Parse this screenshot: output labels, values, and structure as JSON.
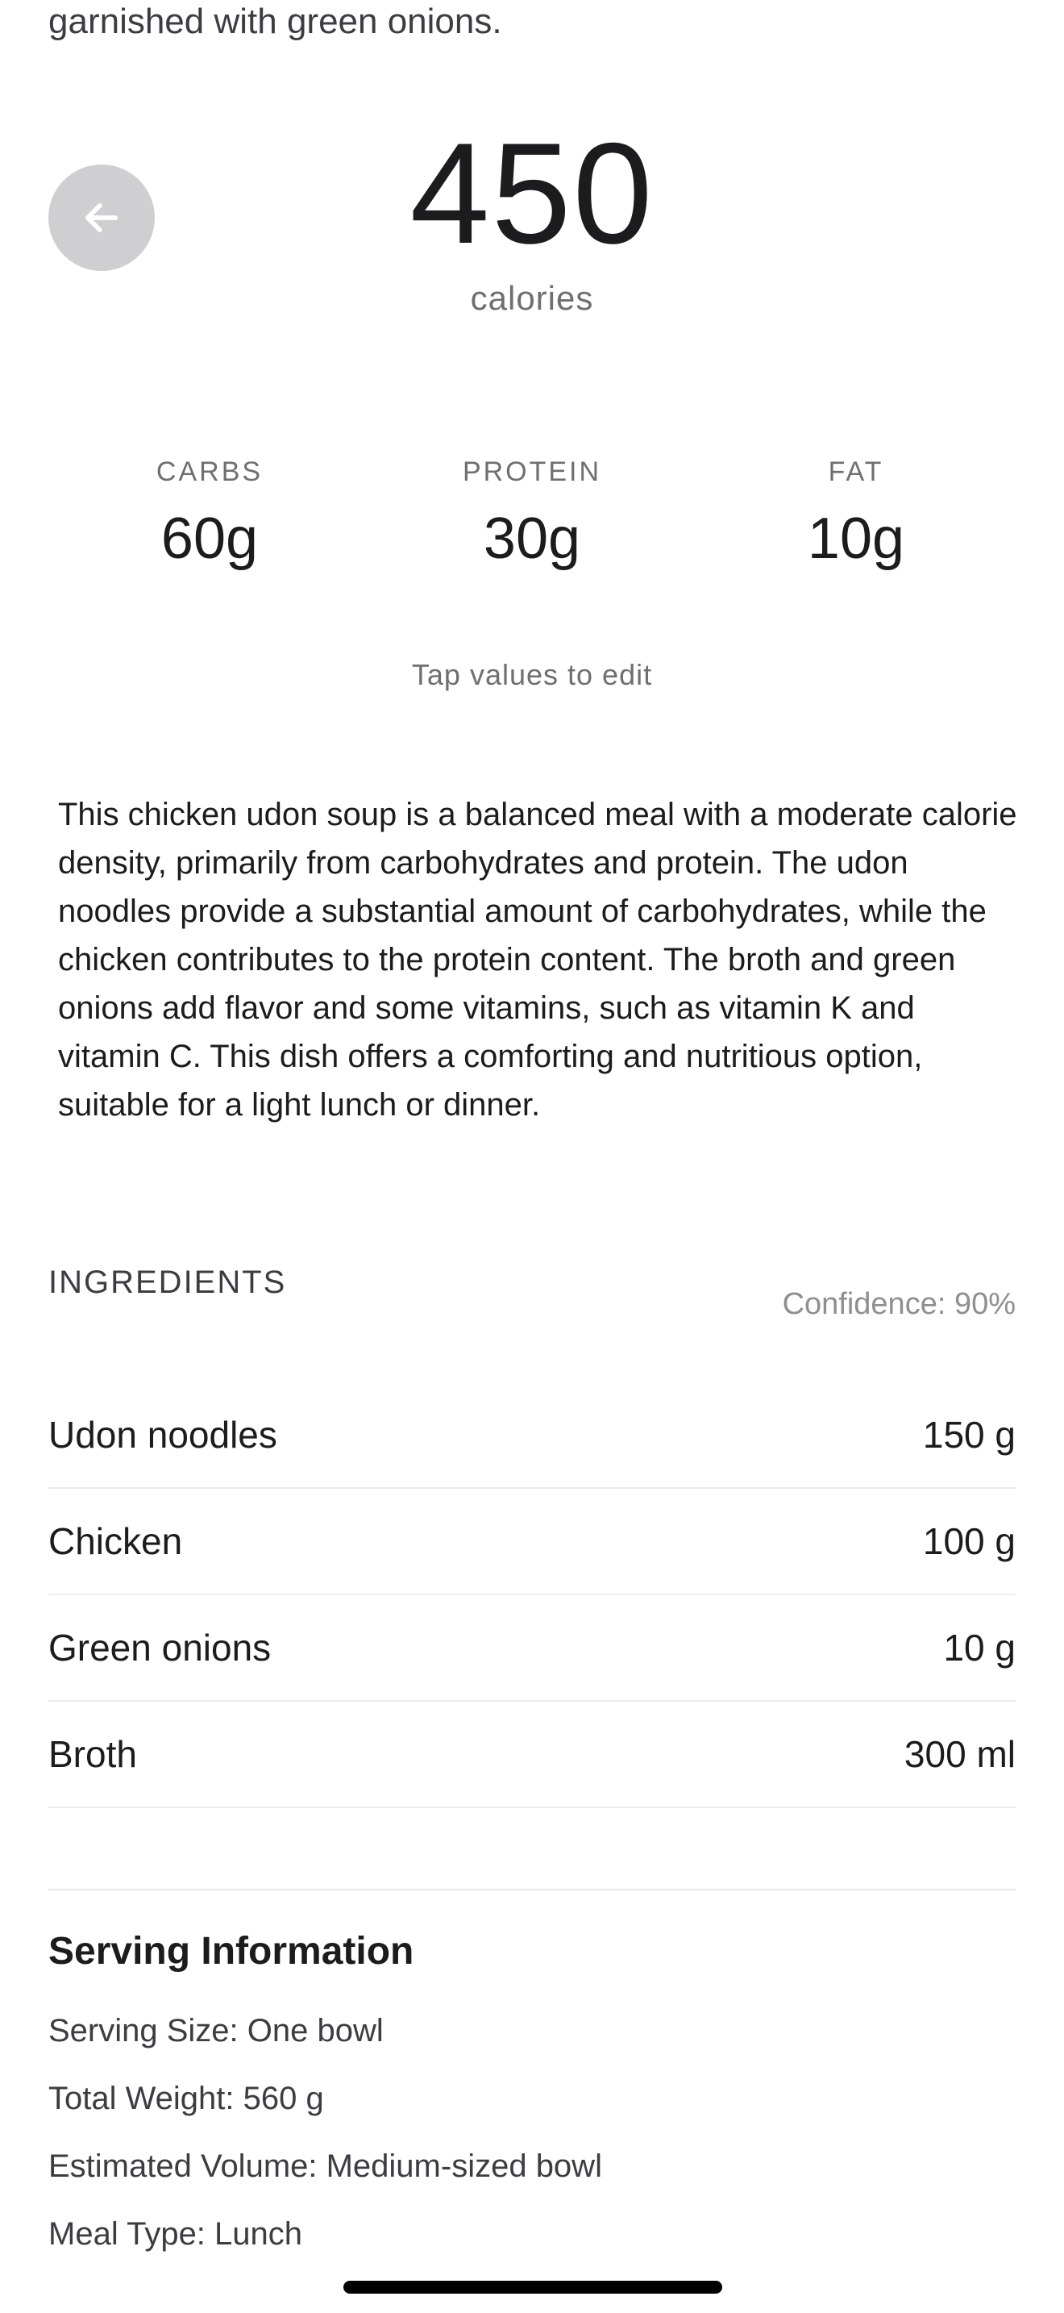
{
  "description_tail": "garnished with green onions.",
  "calories": {
    "value": "450",
    "label": "calories"
  },
  "macros": [
    {
      "label": "CARBS",
      "value": "60g"
    },
    {
      "label": "PROTEIN",
      "value": "30g"
    },
    {
      "label": "FAT",
      "value": "10g"
    }
  ],
  "tap_hint": "Tap values to edit",
  "summary": "This chicken udon soup is a balanced meal with a moderate calorie density, primarily from carbohydrates and protein. The udon noodles provide a substantial amount of carbohydrates, while the chicken contributes to the protein content. The broth and green onions add flavor and some vitamins, such as vitamin K and vitamin C. This dish offers a comforting and nutritious option, suitable for a light lunch or dinner.",
  "ingredients": {
    "title": "INGREDIENTS",
    "confidence": "Confidence: 90%",
    "items": [
      {
        "name": "Udon noodles",
        "amount": "150 g"
      },
      {
        "name": "Chicken",
        "amount": "100 g"
      },
      {
        "name": "Green onions",
        "amount": "10 g"
      },
      {
        "name": "Broth",
        "amount": "300 ml"
      }
    ]
  },
  "serving": {
    "title": "Serving Information",
    "lines": [
      "Serving Size: One bowl",
      "Total Weight: 560 g",
      "Estimated Volume: Medium-sized bowl",
      "Meal Type: Lunch"
    ]
  },
  "icons": {
    "back": "arrow-left-icon"
  },
  "colors": {
    "back_button_bg": "#cfcfd1",
    "primary_text": "#1c1c1e",
    "secondary_text": "#6e6e73"
  }
}
